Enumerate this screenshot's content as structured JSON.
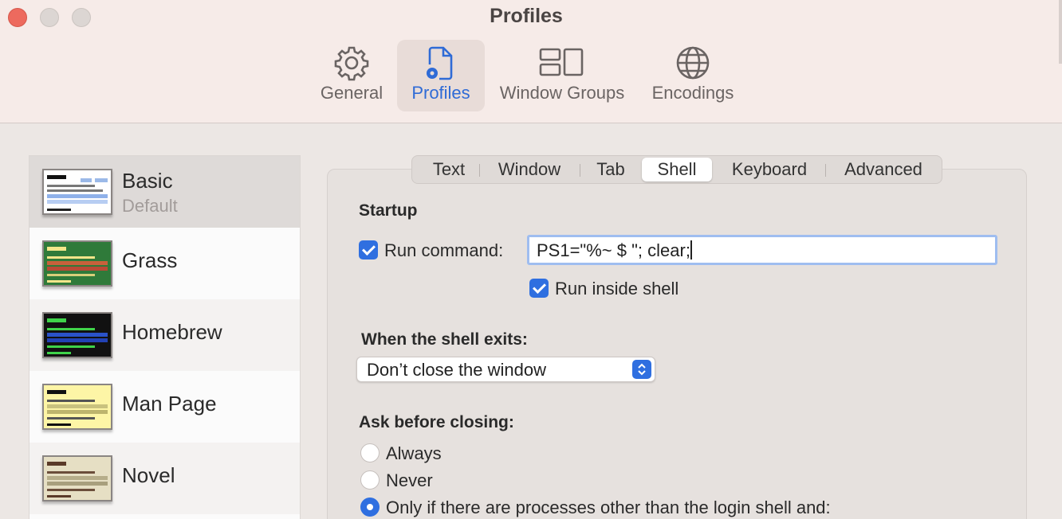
{
  "window": {
    "title": "Profiles"
  },
  "toolbar": {
    "items": [
      {
        "label": "General",
        "icon": "gear-icon"
      },
      {
        "label": "Profiles",
        "icon": "profiles-icon",
        "active": true
      },
      {
        "label": "Window Groups",
        "icon": "window-groups-icon"
      },
      {
        "label": "Encodings",
        "icon": "globe-icon"
      }
    ]
  },
  "profiles": [
    {
      "name": "Basic",
      "subtitle": "Default",
      "bg": "#ffffff",
      "fg": "#111111",
      "selected": true
    },
    {
      "name": "Grass",
      "subtitle": "",
      "bg": "#2f7a3a",
      "fg": "#f3e58a"
    },
    {
      "name": "Homebrew",
      "subtitle": "",
      "bg": "#111111",
      "fg": "#3fd34a"
    },
    {
      "name": "Man Page",
      "subtitle": "",
      "bg": "#fdf5a6",
      "fg": "#111111"
    },
    {
      "name": "Novel",
      "subtitle": "",
      "bg": "#e6dfc4",
      "fg": "#5a3a28"
    }
  ],
  "tabs": [
    "Text",
    "Window",
    "Tab",
    "Shell",
    "Keyboard",
    "Advanced"
  ],
  "active_tab": "Shell",
  "startup": {
    "heading": "Startup",
    "run_command_label": "Run command:",
    "run_command_checked": true,
    "run_command_value": "PS1=\"%~ $ \"; clear;",
    "run_inside_shell_label": "Run inside shell",
    "run_inside_shell_checked": true
  },
  "shell_exit": {
    "heading": "When the shell exits:",
    "selected": "Don’t close the window"
  },
  "ask_closing": {
    "heading": "Ask before closing:",
    "options": [
      "Always",
      "Never",
      "Only if there are processes other than the login shell and:"
    ],
    "selected_index": 2
  },
  "colors": {
    "accent": "#2f6fe0",
    "active_tool_label": "#2f6bd6"
  }
}
